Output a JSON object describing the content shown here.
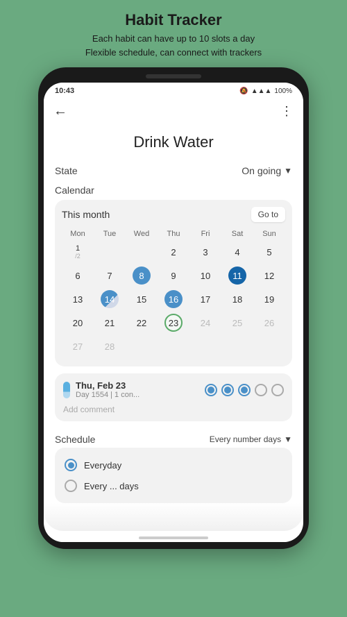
{
  "hero": {
    "title": "Habit Tracker",
    "subtitle_line1": "Each habit can have up to 10 slots a day",
    "subtitle_line2": "Flexible schedule, can connect with trackers"
  },
  "status_bar": {
    "time": "10:43",
    "battery": "100%"
  },
  "habit": {
    "title": "Drink Water",
    "state_label": "State",
    "state_value": "On going"
  },
  "calendar": {
    "section_label": "Calendar",
    "month_label": "This month",
    "goto_btn": "Go to",
    "weekdays": [
      "Mon",
      "Tue",
      "Wed",
      "Thu",
      "Fri",
      "Sat",
      "Sun"
    ],
    "rows": [
      [
        {
          "num": "1",
          "sub": "/2",
          "type": "normal"
        },
        {
          "num": "",
          "type": "empty"
        },
        {
          "num": "",
          "type": "empty"
        },
        {
          "num": "2",
          "type": "normal"
        },
        {
          "num": "3",
          "type": "normal"
        },
        {
          "num": "4",
          "type": "normal"
        },
        {
          "num": "5",
          "type": "normal"
        }
      ],
      [
        {
          "num": "6",
          "type": "normal"
        },
        {
          "num": "7",
          "type": "normal"
        },
        {
          "num": "8",
          "type": "filled"
        },
        {
          "num": "9",
          "type": "normal"
        },
        {
          "num": "10",
          "type": "normal"
        },
        {
          "num": "11",
          "type": "filled-dark"
        },
        {
          "num": "12",
          "type": "normal"
        }
      ],
      [
        {
          "num": "13",
          "type": "normal"
        },
        {
          "num": "14",
          "type": "partial"
        },
        {
          "num": "15",
          "type": "normal"
        },
        {
          "num": "16",
          "type": "filled"
        },
        {
          "num": "17",
          "type": "normal"
        },
        {
          "num": "18",
          "type": "normal"
        },
        {
          "num": "19",
          "type": "normal"
        }
      ],
      [
        {
          "num": "20",
          "type": "normal"
        },
        {
          "num": "21",
          "type": "normal"
        },
        {
          "num": "22",
          "type": "normal"
        },
        {
          "num": "23",
          "type": "today"
        },
        {
          "num": "24",
          "type": "faded"
        },
        {
          "num": "25",
          "type": "faded"
        },
        {
          "num": "26",
          "type": "faded"
        }
      ],
      [
        {
          "num": "27",
          "type": "faded"
        },
        {
          "num": "28",
          "type": "faded"
        },
        {
          "num": "",
          "type": "empty"
        },
        {
          "num": "",
          "type": "empty"
        },
        {
          "num": "",
          "type": "empty"
        },
        {
          "num": "",
          "type": "empty"
        },
        {
          "num": "",
          "type": "empty"
        }
      ]
    ]
  },
  "day_detail": {
    "date": "Thu, Feb 23",
    "sub": "Day 1554 | 1 con...",
    "add_comment": "Add comment",
    "circles": [
      {
        "type": "filled"
      },
      {
        "type": "filled"
      },
      {
        "type": "filled"
      },
      {
        "type": "empty"
      },
      {
        "type": "empty"
      }
    ]
  },
  "schedule": {
    "label": "Schedule",
    "value": "Every number days",
    "options": [
      {
        "label": "Everyday",
        "selected": true
      },
      {
        "label": "Every ... days",
        "selected": false
      }
    ]
  }
}
